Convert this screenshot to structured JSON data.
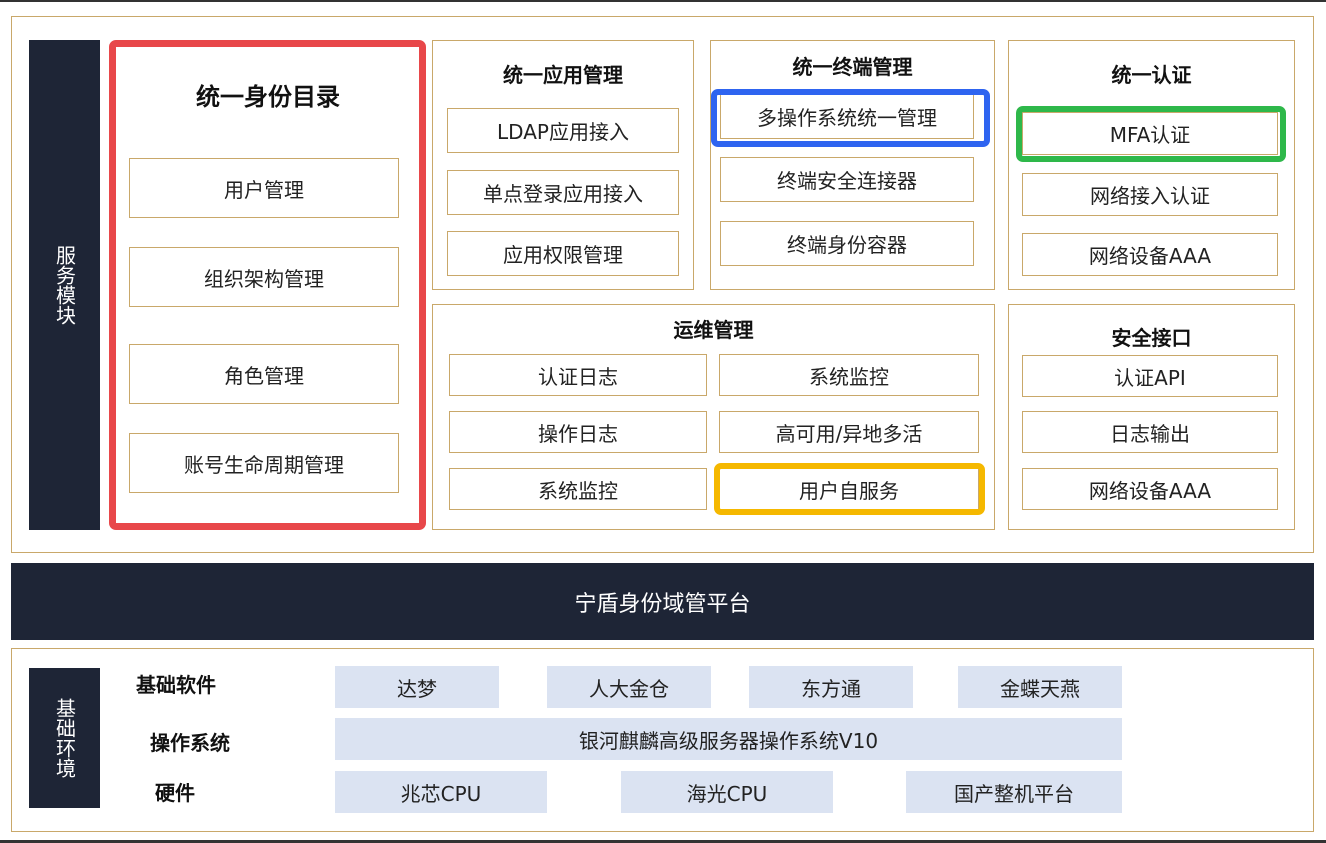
{
  "service_modules": {
    "label": "服务模块",
    "identity_directory": {
      "title": "统一身份目录",
      "items": [
        "用户管理",
        "组织架构管理",
        "角色管理",
        "账号生命周期管理"
      ]
    },
    "app_management": {
      "title": "统一应用管理",
      "items": [
        "LDAP应用接入",
        "单点登录应用接入",
        "应用权限管理"
      ]
    },
    "terminal_management": {
      "title": "统一终端管理",
      "items": [
        "多操作系统统一管理",
        "终端安全连接器",
        "终端身份容器"
      ]
    },
    "unified_auth": {
      "title": "统一认证",
      "items": [
        "MFA认证",
        "网络接入认证",
        "网络设备AAA"
      ]
    },
    "ops_management": {
      "title": "运维管理",
      "left_items": [
        "认证日志",
        "操作日志",
        "系统监控"
      ],
      "right_items": [
        "系统监控",
        "高可用/异地多活",
        "用户自服务"
      ]
    },
    "security_interface": {
      "title": "安全接口",
      "items": [
        "认证API",
        "日志输出",
        "网络设备AAA"
      ]
    }
  },
  "platform": {
    "label": "宁盾身份域管平台"
  },
  "infrastructure": {
    "label": "基础环境",
    "rows": [
      {
        "category": "基础软件",
        "items": [
          "达梦",
          "人大金仓",
          "东方通",
          "金蝶天燕"
        ]
      },
      {
        "category": "操作系统",
        "items": [
          "银河麒麟高级服务器操作系统V10"
        ]
      },
      {
        "category": "硬件",
        "items": [
          "兆芯CPU",
          "海光CPU",
          "国产整机平台"
        ]
      }
    ]
  },
  "highlight_colors": {
    "red": "#e8474a",
    "blue": "#2e64f0",
    "green": "#2eb84a",
    "yellow": "#f5b800"
  }
}
